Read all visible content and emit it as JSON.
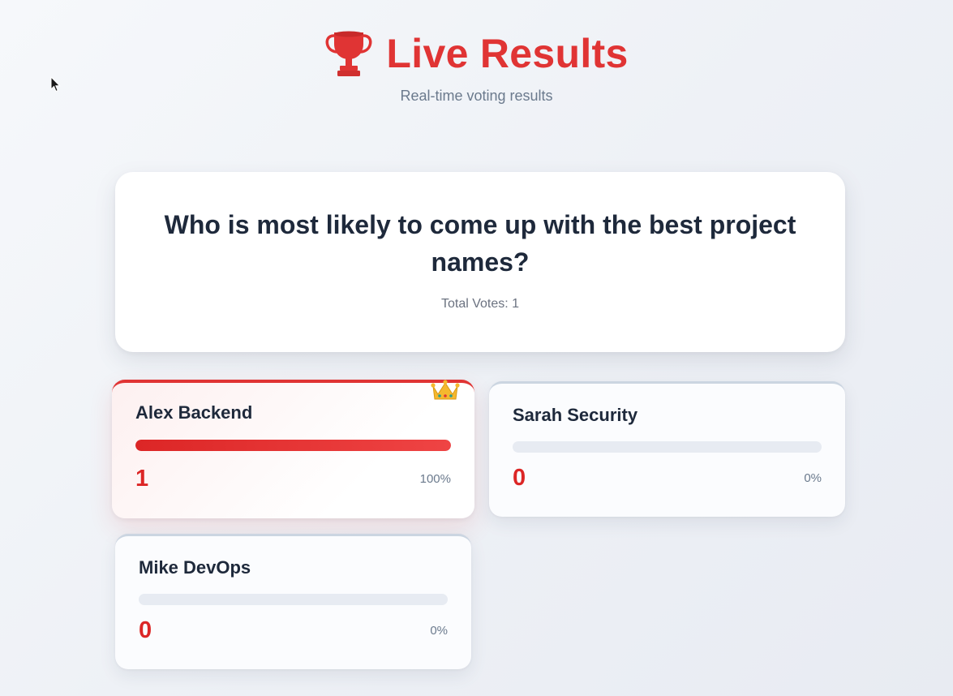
{
  "header": {
    "title": "Live Results",
    "subtitle": "Real-time voting results",
    "trophy_icon": "trophy-icon",
    "accent_color": "#e03434"
  },
  "question": {
    "text": "Who is most likely to come up with the best project names?",
    "total_votes_label": "Total Votes: 1"
  },
  "options": [
    {
      "name": "Alex Backend",
      "votes": "1",
      "percent_label": "100%",
      "percent": 100,
      "leader": true,
      "badge_icon": "crown-icon"
    },
    {
      "name": "Sarah Security",
      "votes": "0",
      "percent_label": "0%",
      "percent": 0,
      "leader": false
    },
    {
      "name": "Mike DevOps",
      "votes": "0",
      "percent_label": "0%",
      "percent": 0,
      "leader": false
    }
  ]
}
